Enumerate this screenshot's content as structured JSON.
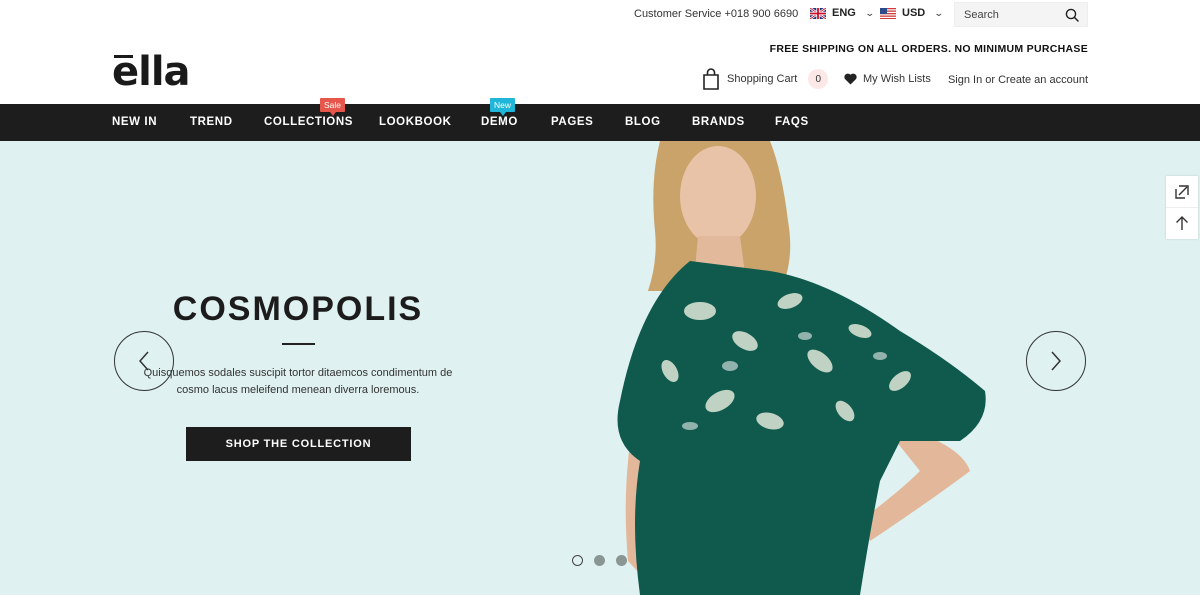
{
  "topbar": {
    "customer_service": "Customer Service +018 900 6690",
    "language": "ENG",
    "currency": "USD",
    "search_placeholder": "Search"
  },
  "header": {
    "logo": "ella",
    "free_shipping": "FREE SHIPPING ON ALL ORDERS. NO MINIMUM PURCHASE",
    "cart_label": "Shopping Cart",
    "cart_count": "0",
    "wishlist_label": "My Wish Lists",
    "signin_label": "Sign In or Create an account"
  },
  "nav": {
    "items": [
      {
        "label": "NEW IN"
      },
      {
        "label": "TREND"
      },
      {
        "label": "COLLECTIONS",
        "badge": "Sale"
      },
      {
        "label": "LOOKBOOK"
      },
      {
        "label": "DEMO",
        "badge": "New"
      },
      {
        "label": "PAGES"
      },
      {
        "label": "BLOG"
      },
      {
        "label": "BRANDS"
      },
      {
        "label": "FAQS"
      }
    ]
  },
  "hero": {
    "title": "COSMOPOLIS",
    "description": "Quisquemos sodales suscipit tortor ditaemcos condimentum de cosmo lacus meleifend menean diverra loremous.",
    "button_label": "SHOP THE COLLECTION",
    "slides_total": 3,
    "active_slide": 1
  },
  "colors": {
    "nav_bg": "#1d1d1d",
    "hero_bg": "#dff1f0",
    "badge_sale": "#e6564b",
    "badge_new": "#1fb6d9",
    "top_green": "#0f5a4c"
  },
  "icons": [
    "uk-flag-icon",
    "us-flag-icon",
    "search-icon",
    "bag-icon",
    "heart-icon",
    "chevron-left-icon",
    "chevron-right-icon",
    "compare-icon",
    "arrow-up-icon"
  ]
}
